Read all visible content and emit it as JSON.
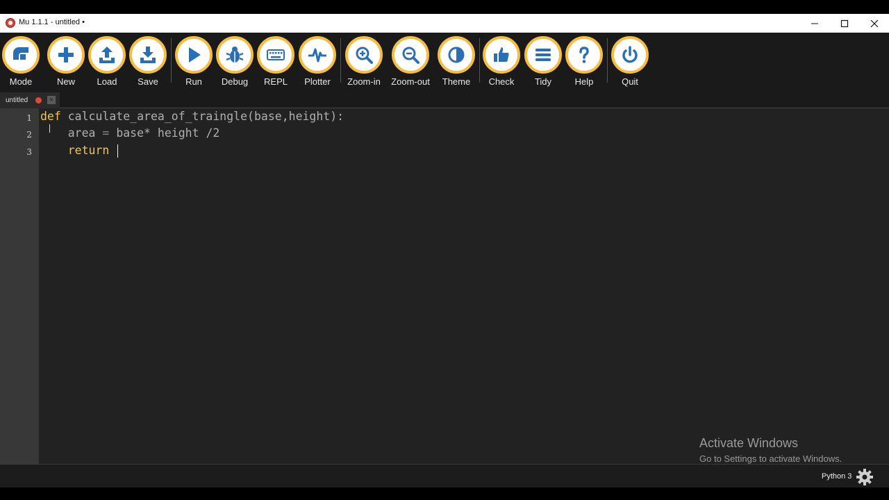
{
  "window": {
    "title": "Mu 1.1.1 - untitled •",
    "controls": [
      "minimize-icon",
      "maximize-icon",
      "close-icon"
    ]
  },
  "toolbar": {
    "accent_color": "#f5bd43",
    "buttons": [
      {
        "label": "Mode",
        "icon": "mode-icon"
      },
      {
        "label": "New",
        "icon": "plus-icon"
      },
      {
        "label": "Load",
        "icon": "upload-icon"
      },
      {
        "label": "Save",
        "icon": "download-icon"
      },
      {
        "label": "Run",
        "icon": "play-icon"
      },
      {
        "label": "Debug",
        "icon": "bug-icon"
      },
      {
        "label": "REPL",
        "icon": "keyboard-icon"
      },
      {
        "label": "Plotter",
        "icon": "pulse-icon"
      },
      {
        "label": "Zoom-in",
        "icon": "zoom-in-icon"
      },
      {
        "label": "Zoom-out",
        "icon": "zoom-out-icon"
      },
      {
        "label": "Theme",
        "icon": "contrast-icon"
      },
      {
        "label": "Check",
        "icon": "thumbs-up-icon"
      },
      {
        "label": "Tidy",
        "icon": "lines-icon"
      },
      {
        "label": "Help",
        "icon": "question-icon"
      },
      {
        "label": "Quit",
        "icon": "power-icon"
      }
    ]
  },
  "tabs": [
    {
      "label": "untitled",
      "modified": true
    }
  ],
  "editor": {
    "line_numbers": [
      "1",
      "2",
      "3"
    ],
    "lines": [
      {
        "keyword": "def",
        "rest": " calculate_area_of_traingle(base,height):"
      },
      {
        "indent": "    ",
        "name": "area",
        "op": " = ",
        "expr": "base* height /2"
      },
      {
        "indent": "    ",
        "keyword": "return"
      }
    ]
  },
  "watermark": {
    "title": "Activate Windows",
    "subtitle": "Go to Settings to activate Windows."
  },
  "status": {
    "mode": "Python 3",
    "settings_icon": "gear-icon"
  }
}
